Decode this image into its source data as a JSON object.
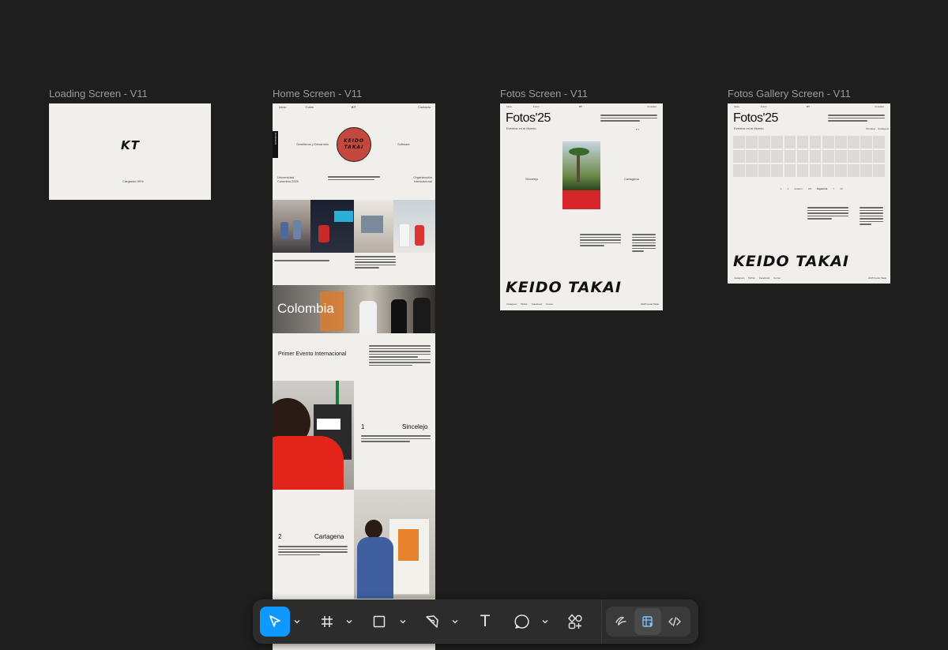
{
  "frames": {
    "loading": {
      "title": "Loading Screen - V11",
      "logo": "KT",
      "caption": "Cargando 99%"
    },
    "home": {
      "title": "Home Screen - V11",
      "nav": [
        "Inicio",
        "Fotos",
        "KT",
        "Contacto"
      ],
      "side_tab": "Conócenos",
      "hero_left": "Semilleros y Desarrollo",
      "hero_right": "Software",
      "logo_text": "KEIDO TAKAI",
      "row_left": "Universidad Colombia 2025",
      "row_right": "Organización Internacional",
      "section_country": "Colombia",
      "event_title": "Primer Evento Internacional",
      "city1_num": "1",
      "city1_name": "Sincelejo",
      "city2_num": "2",
      "city2_name": "Cartagena"
    },
    "fotos": {
      "title": "Fotos Screen - V11",
      "heading": "Fotos'25",
      "sub": "Eventos en el Mundo",
      "city_left": "Sincelejo",
      "city_right": "Cartagena",
      "brand": "KEIDO TAKAI",
      "footer": [
        "Instagram",
        "TikTok",
        "Facebook",
        "Correo"
      ],
      "footer_right": "2025 Keido Takai"
    },
    "gallery": {
      "title": "Fotos Gallery Screen - V11",
      "heading": "Fotos'25",
      "sub": "Eventos en el Mundo",
      "tabs": [
        "Sincelejo",
        "Cartagena"
      ],
      "pager": [
        "1",
        "2",
        "Anterior",
        "3/4",
        "Siguiente",
        "7",
        "10"
      ],
      "brand": "KEIDO TAKAI",
      "footer": [
        "Instagram",
        "TikTok",
        "Facebook",
        "Correo"
      ],
      "footer_right": "2025 Keido Takai"
    }
  },
  "toolbar": {
    "tools": [
      {
        "name": "move-tool",
        "icon": "cursor-icon",
        "active": true
      },
      {
        "name": "frame-tool",
        "icon": "hash-frame-icon"
      },
      {
        "name": "shape-tool",
        "icon": "rectangle-icon"
      },
      {
        "name": "pen-tool",
        "icon": "pen-icon"
      },
      {
        "name": "text-tool",
        "icon": "text-icon"
      },
      {
        "name": "comment-tool",
        "icon": "comment-icon"
      },
      {
        "name": "actions-tool",
        "icon": "shapes-plus-icon"
      }
    ],
    "modes": [
      {
        "name": "draw-mode",
        "icon": "draw-icon"
      },
      {
        "name": "design-mode",
        "icon": "design-icon",
        "active": true
      },
      {
        "name": "dev-mode",
        "icon": "code-icon"
      }
    ],
    "accent": "#0d99ff",
    "text_glyph": "T"
  }
}
